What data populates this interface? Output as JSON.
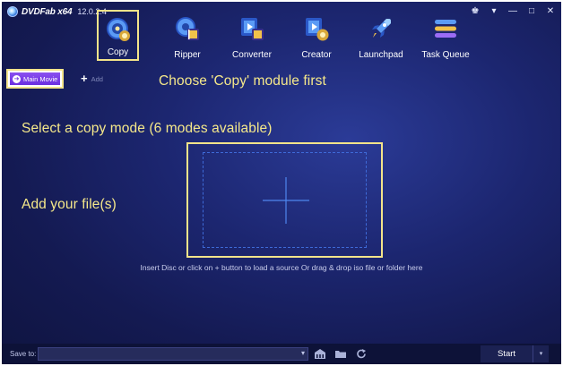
{
  "app": {
    "logo_text": "DVDFab x64",
    "version": "12.0.2.4"
  },
  "window_controls": {
    "skin": "♚",
    "menu": "▾",
    "minimize": "—",
    "maximize": "□",
    "close": "✕"
  },
  "modules": [
    {
      "label": "Copy",
      "icon": "disc-copy-icon",
      "active": true
    },
    {
      "label": "Ripper",
      "icon": "disc-ripper-icon"
    },
    {
      "label": "Converter",
      "icon": "converter-film-icon"
    },
    {
      "label": "Creator",
      "icon": "creator-film-disc-icon"
    },
    {
      "label": "Launchpad",
      "icon": "rocket-icon"
    },
    {
      "label": "Task Queue",
      "icon": "task-queue-icon"
    }
  ],
  "toolbar": {
    "main_movie_label": "Main Movie",
    "add_label": "Add"
  },
  "annotations": {
    "copy_module": "Choose 'Copy' module first",
    "copy_mode": "Select a copy mode (6 modes available)",
    "add_files": "Add your file(s)"
  },
  "drop_zone": {
    "hint": "Insert Disc or click on + button to load a source Or drag & drop iso file or folder here"
  },
  "bottom_bar": {
    "save_label": "Save to:",
    "save_value": "",
    "start_label": "Start"
  },
  "colors": {
    "annotation": "#f5e88a",
    "main_movie": "#7a3ff0",
    "background": "#1c2670",
    "dashed_border": "#3e6ad8"
  }
}
